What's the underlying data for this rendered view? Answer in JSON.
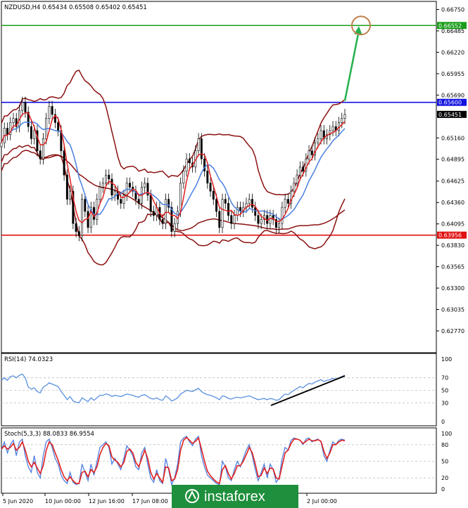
{
  "chart_data": [
    {
      "type": "candlestick",
      "title": "NZDUSD,H4  0.65434 0.65508 0.65402 0.65451",
      "ylim": [
        0.625,
        0.6685
      ],
      "yticks": [
        "0.66750",
        "0.66485",
        "0.66220",
        "0.65955",
        "0.65690",
        "0.65160",
        "0.64895",
        "0.64625",
        "0.64360",
        "0.64095",
        "0.63830",
        "0.63565",
        "0.63300",
        "0.63035",
        "0.62770"
      ],
      "yticks_values": [
        0.6675,
        0.66485,
        0.6622,
        0.65955,
        0.6569,
        0.6516,
        0.64895,
        0.64625,
        0.6436,
        0.64095,
        0.6383,
        0.63565,
        0.633,
        0.63035,
        0.6277
      ],
      "xticks": [
        "5 Jun 2020",
        "10 Jun 00:00",
        "12 Jun 16:00",
        "17 Jun 08:00",
        "2 Jul 00:00"
      ],
      "levels": [
        {
          "label": "0.66552",
          "value": 0.66552,
          "color": "#1a9e1a"
        },
        {
          "label": "0.65600",
          "value": 0.656,
          "color": "#1010e0"
        },
        {
          "label": "0.63956",
          "value": 0.63956,
          "color": "#e01010"
        }
      ],
      "current_price": {
        "label": "0.65451",
        "value": 0.65451
      },
      "close": [
        0.651,
        0.6528,
        0.652,
        0.6535,
        0.654,
        0.653,
        0.655,
        0.656,
        0.6548,
        0.653,
        0.6515,
        0.6525,
        0.65,
        0.649,
        0.6515,
        0.654,
        0.6555,
        0.6545,
        0.6535,
        0.6525,
        0.65,
        0.647,
        0.644,
        0.645,
        0.641,
        0.64,
        0.6395,
        0.644,
        0.6425,
        0.6405,
        0.643,
        0.6415,
        0.644,
        0.6455,
        0.646,
        0.647,
        0.6465,
        0.6445,
        0.645,
        0.644,
        0.6435,
        0.6445,
        0.646,
        0.6455,
        0.645,
        0.644,
        0.6435,
        0.6455,
        0.646,
        0.6445,
        0.6425,
        0.642,
        0.643,
        0.6415,
        0.641,
        0.644,
        0.643,
        0.64,
        0.641,
        0.6425,
        0.646,
        0.6475,
        0.649,
        0.6485,
        0.648,
        0.65,
        0.6515,
        0.649,
        0.6475,
        0.646,
        0.645,
        0.644,
        0.6425,
        0.6405,
        0.644,
        0.6435,
        0.642,
        0.641,
        0.642,
        0.643,
        0.6425,
        0.643,
        0.6435,
        0.644,
        0.643,
        0.642,
        0.641,
        0.6415,
        0.642,
        0.641,
        0.642,
        0.6415,
        0.6405,
        0.641,
        0.643,
        0.644,
        0.6435,
        0.645,
        0.646,
        0.647,
        0.648,
        0.6475,
        0.649,
        0.65,
        0.6495,
        0.651,
        0.6515,
        0.6525,
        0.6515,
        0.652,
        0.6525,
        0.653,
        0.6525,
        0.6535,
        0.654,
        0.6545
      ]
    },
    {
      "type": "line",
      "title": "RSI(14) 74.0323",
      "ylim": [
        0,
        100
      ],
      "yticks": [
        "100",
        "70",
        "50",
        "30",
        "0"
      ],
      "yticks_values": [
        100,
        70,
        50,
        30,
        0
      ],
      "values": [
        66,
        70,
        66,
        72,
        73,
        70,
        74,
        76,
        70,
        55,
        52,
        54,
        48,
        46,
        55,
        58,
        62,
        60,
        58,
        56,
        48,
        42,
        35,
        40,
        33,
        31,
        30,
        38,
        35,
        32,
        38,
        34,
        38,
        42,
        42,
        44,
        43,
        40,
        42,
        41,
        40,
        42,
        44,
        43,
        42,
        40,
        39,
        42,
        43,
        40,
        37,
        36,
        38,
        35,
        34,
        41,
        38,
        33,
        35,
        38,
        44,
        47,
        50,
        49,
        48,
        51,
        53,
        48,
        45,
        43,
        42,
        40,
        38,
        35,
        41,
        40,
        37,
        36,
        38,
        39,
        38,
        39,
        40,
        41,
        39,
        37,
        35,
        36,
        37,
        35,
        37,
        36,
        34,
        35,
        40,
        44,
        43,
        47,
        50,
        53,
        56,
        54,
        58,
        61,
        60,
        63,
        65,
        67,
        64,
        66,
        67,
        69,
        68,
        70,
        72,
        74
      ]
    },
    {
      "type": "line",
      "title": "Stoch(5,3,3) 88.0833 86.9554",
      "ylim": [
        0,
        100
      ],
      "yticks": [
        "100",
        "80",
        "50",
        "20",
        "0"
      ],
      "yticks_values": [
        100,
        80,
        50,
        20,
        0
      ],
      "series": [
        {
          "color": "#5080e0",
          "values": [
            70,
            85,
            65,
            80,
            88,
            60,
            85,
            90,
            60,
            40,
            30,
            60,
            30,
            20,
            60,
            85,
            90,
            75,
            55,
            45,
            25,
            15,
            10,
            30,
            12,
            8,
            10,
            45,
            30,
            15,
            45,
            25,
            50,
            75,
            80,
            85,
            75,
            45,
            55,
            45,
            35,
            55,
            78,
            70,
            60,
            40,
            35,
            65,
            75,
            45,
            20,
            12,
            35,
            15,
            10,
            55,
            35,
            8,
            20,
            45,
            85,
            92,
            95,
            85,
            78,
            90,
            95,
            60,
            40,
            25,
            20,
            15,
            10,
            8,
            50,
            40,
            20,
            15,
            35,
            50,
            40,
            55,
            70,
            80,
            60,
            35,
            15,
            30,
            45,
            20,
            45,
            35,
            12,
            20,
            55,
            75,
            70,
            88,
            92,
            90,
            88,
            80,
            90,
            92,
            85,
            88,
            90,
            85,
            60,
            50,
            70,
            85,
            80,
            88,
            90,
            88
          ]
        },
        {
          "color": "#e02020",
          "values": [
            72,
            78,
            72,
            75,
            82,
            70,
            75,
            85,
            70,
            50,
            40,
            48,
            38,
            28,
            42,
            70,
            85,
            80,
            65,
            52,
            35,
            22,
            15,
            22,
            15,
            10,
            10,
            30,
            32,
            22,
            35,
            30,
            40,
            62,
            75,
            82,
            78,
            58,
            52,
            48,
            40,
            48,
            68,
            72,
            65,
            48,
            40,
            55,
            70,
            55,
            30,
            18,
            28,
            20,
            12,
            40,
            38,
            15,
            18,
            35,
            70,
            88,
            93,
            88,
            82,
            86,
            92,
            72,
            50,
            32,
            24,
            18,
            13,
            10,
            35,
            42,
            28,
            18,
            28,
            42,
            42,
            50,
            62,
            75,
            65,
            45,
            22,
            25,
            38,
            28,
            38,
            36,
            20,
            18,
            42,
            65,
            70,
            82,
            90,
            90,
            88,
            82,
            86,
            90,
            87,
            87,
            89,
            86,
            68,
            55,
            65,
            80,
            80,
            85,
            88,
            87
          ]
        }
      ]
    }
  ],
  "watermark": {
    "icon": "instaforex-logo-icon",
    "text": "instaforex"
  },
  "annotations": {
    "target_circle_color": "#c0804a",
    "arrow_color": "#22b14c",
    "rsi_trend_line_color": "#000000"
  }
}
